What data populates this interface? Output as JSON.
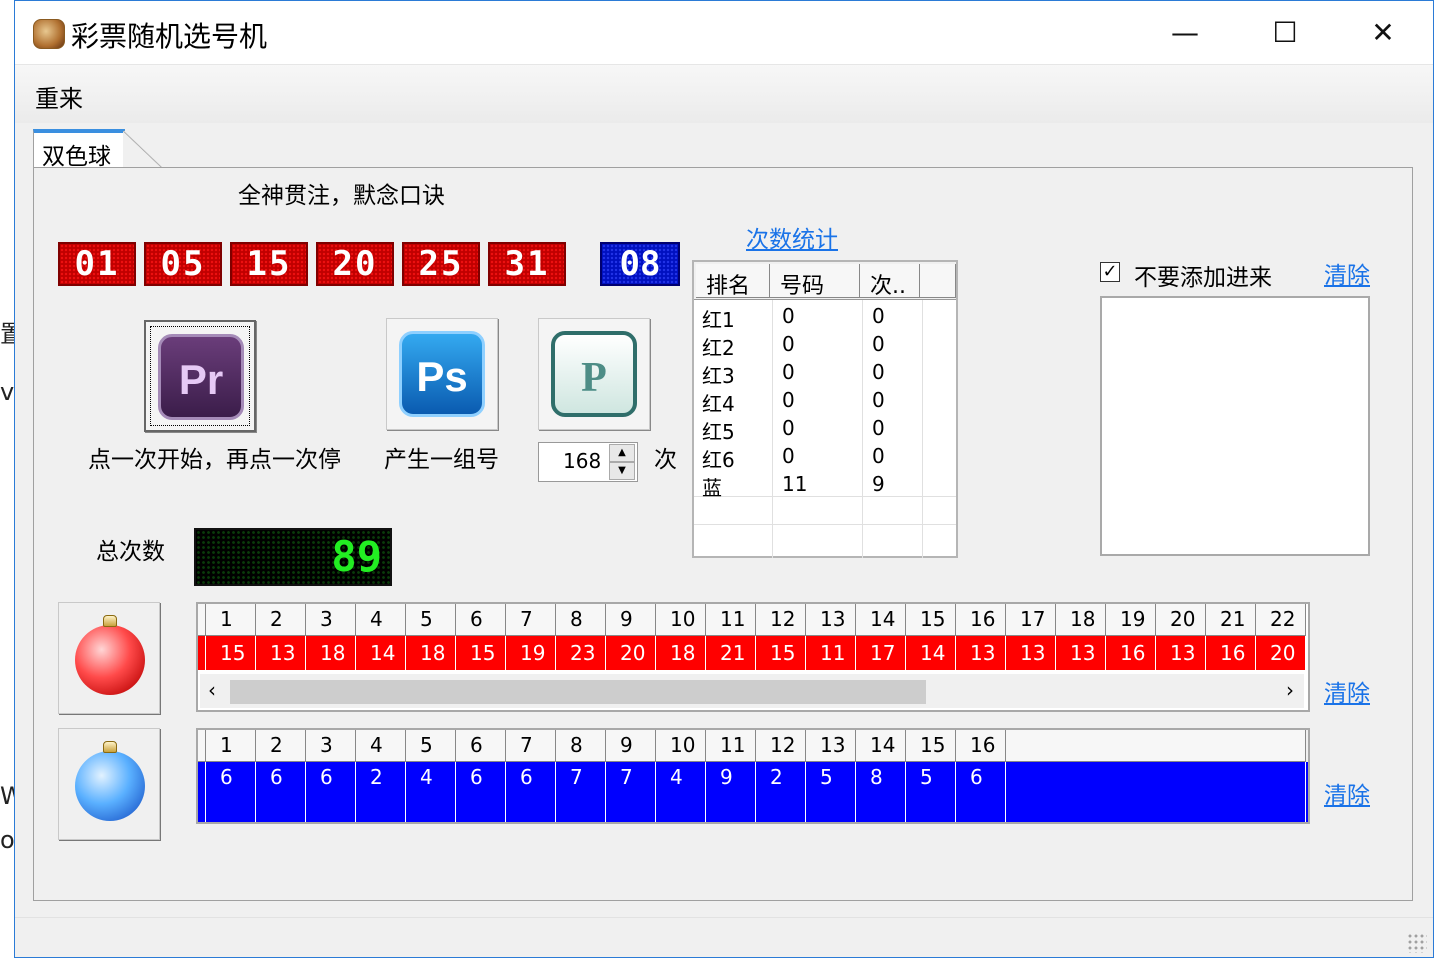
{
  "background_fragments": [
    "置",
    "ve",
    "W",
    "o:"
  ],
  "window": {
    "title": "彩票随机选号机",
    "controls": [
      "—",
      "☐",
      "✕"
    ]
  },
  "menu": {
    "items": [
      "重来"
    ]
  },
  "tab": {
    "label": "双色球"
  },
  "instruction": "全神贯注，默念口诀",
  "red_balls": [
    "01",
    "05",
    "15",
    "20",
    "25",
    "31"
  ],
  "blue_ball": "08",
  "buttons": {
    "start_stop": {
      "icon": "Pr",
      "caption": "点一次开始，再点一次停"
    },
    "generate": {
      "icon": "Ps",
      "caption": "产生一组号"
    },
    "repeat": {
      "icon": "P"
    }
  },
  "repeat_spinner": {
    "value": "168",
    "unit": "次"
  },
  "stats": {
    "title_link": "次数统计",
    "columns": [
      "排名",
      "号码",
      "次.."
    ],
    "rows": [
      [
        "红1",
        "0",
        "0"
      ],
      [
        "红2",
        "0",
        "0"
      ],
      [
        "红3",
        "0",
        "0"
      ],
      [
        "红4",
        "0",
        "0"
      ],
      [
        "红5",
        "0",
        "0"
      ],
      [
        "红6",
        "0",
        "0"
      ],
      [
        "蓝",
        "11",
        "9"
      ]
    ]
  },
  "exclude": {
    "checked": true,
    "checkmark": "✓",
    "label": "不要添加进来",
    "clear_link": "清除"
  },
  "total": {
    "label": "总次数",
    "value": "89"
  },
  "red_history": {
    "headers": [
      "1",
      "2",
      "3",
      "4",
      "5",
      "6",
      "7",
      "8",
      "9",
      "10",
      "11",
      "12",
      "13",
      "14",
      "15",
      "16",
      "17",
      "18",
      "19",
      "20",
      "21",
      "22"
    ],
    "values": [
      "15",
      "13",
      "18",
      "14",
      "18",
      "15",
      "19",
      "23",
      "20",
      "18",
      "21",
      "15",
      "11",
      "17",
      "14",
      "13",
      "13",
      "13",
      "16",
      "13",
      "16",
      "20"
    ],
    "clear_link": "清除",
    "scroll_left": "‹",
    "scroll_right": "›"
  },
  "blue_history": {
    "headers": [
      "1",
      "2",
      "3",
      "4",
      "5",
      "6",
      "7",
      "8",
      "9",
      "10",
      "11",
      "12",
      "13",
      "14",
      "15",
      "16"
    ],
    "values": [
      "6",
      "6",
      "6",
      "2",
      "4",
      "6",
      "6",
      "7",
      "7",
      "4",
      "9",
      "2",
      "5",
      "8",
      "5",
      "6"
    ],
    "clear_link": "清除"
  },
  "colors": {
    "red": "#ff0000",
    "blue": "#0000ff",
    "link": "#1a73e8",
    "led_green": "#22ee22"
  }
}
